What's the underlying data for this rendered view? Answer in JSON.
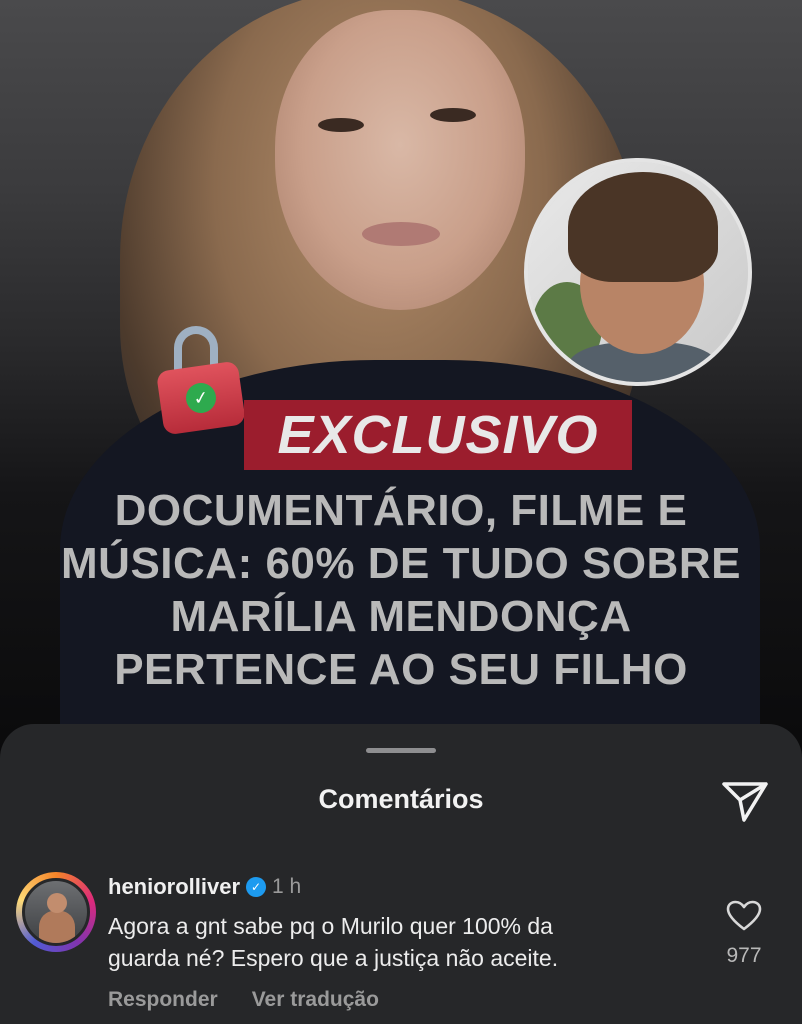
{
  "post": {
    "tag": "EXCLUSIVO",
    "headline_lines": [
      "DOCUMENTÁRIO, FILME E",
      "MÚSICA: 60% DE TUDO SOBRE",
      "MARÍLIA MENDONÇA",
      "PERTENCE AO SEU FILHO"
    ]
  },
  "comments_sheet": {
    "title": "Comentários",
    "send_icon": "send-icon"
  },
  "comment": {
    "username": "heniorolliver",
    "verified": true,
    "time": "1 h",
    "text_lines": [
      "Agora a gnt sabe pq o Murilo quer 100% da",
      "guarda né? Espero que a justiça não aceite."
    ],
    "reply_label": "Responder",
    "translate_label": "Ver tradução",
    "like_count": "977"
  },
  "colors": {
    "tag_bg": "#9b1d2d",
    "sheet_bg": "#262729",
    "verified": "#1d9bf0"
  }
}
